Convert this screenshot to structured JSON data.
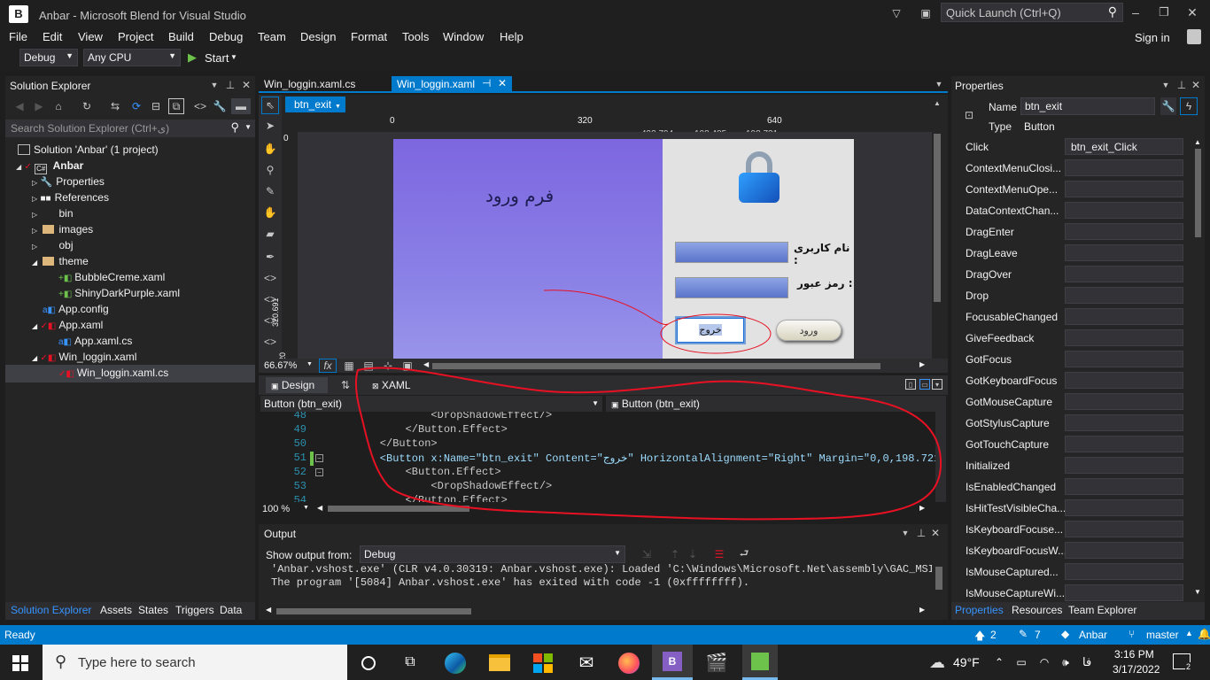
{
  "window": {
    "title": "Anbar - Microsoft Blend for Visual Studio",
    "quick_launch": "Quick Launch (Ctrl+Q)",
    "sign_in": "Sign in"
  },
  "menu": [
    "File",
    "Edit",
    "View",
    "Project",
    "Build",
    "Debug",
    "Team",
    "Design",
    "Format",
    "Tools",
    "Window",
    "Help"
  ],
  "toolbar": {
    "config": "Debug",
    "platform": "Any CPU",
    "start": "Start"
  },
  "solution_explorer": {
    "title": "Solution Explorer",
    "search_placeholder": "Search Solution Explorer (Ctrl+ی)",
    "items": [
      {
        "label": "Solution 'Anbar' (1 project)",
        "icon": "solution-icon"
      },
      {
        "label": "Anbar",
        "icon": "csharp-project-icon"
      },
      {
        "label": "Properties",
        "icon": "wrench-icon"
      },
      {
        "label": "References",
        "icon": "references-icon"
      },
      {
        "label": "bin",
        "icon": "folder-icon"
      },
      {
        "label": "images",
        "icon": "folder-icon"
      },
      {
        "label": "obj",
        "icon": "folder-icon"
      },
      {
        "label": "theme",
        "icon": "folder-icon"
      },
      {
        "label": "BubbleCreme.xaml",
        "icon": "xaml-file-icon"
      },
      {
        "label": "ShinyDarkPurple.xaml",
        "icon": "xaml-file-icon"
      },
      {
        "label": "App.config",
        "icon": "config-file-icon"
      },
      {
        "label": "App.xaml",
        "icon": "xaml-file-icon"
      },
      {
        "label": "App.xaml.cs",
        "icon": "cs-file-icon"
      },
      {
        "label": "Win_loggin.xaml",
        "icon": "xaml-file-icon"
      },
      {
        "label": "Win_loggin.xaml.cs",
        "icon": "cs-file-icon"
      }
    ],
    "bottom_tabs": [
      "Solution Explorer",
      "Assets",
      "States",
      "Triggers",
      "Data"
    ]
  },
  "doc_tabs": [
    "Win_loggin.xaml.cs",
    "Win_loggin.xaml"
  ],
  "designer": {
    "breadcrumb": "btn_exit",
    "ruler": [
      "0",
      "320",
      "640"
    ],
    "dims": [
      "492.794",
      "108.485",
      "198.721"
    ],
    "vruler": [
      "0",
      "320.691",
      "320"
    ],
    "zoom": "66.67%",
    "form_title": "فرم ورود",
    "username_label": "نام کاربری :",
    "password_label": "رمز عبور :",
    "exit_button": "خروج",
    "login_button": "ورود"
  },
  "split_tabs": {
    "design": "Design",
    "xaml": "XAML"
  },
  "code": {
    "left_combo": "Button (btn_exit)",
    "right_combo": "Button (btn_exit)",
    "lines": [
      {
        "n": "48",
        "text": "            <DropShadowEffect/>"
      },
      {
        "n": "49",
        "text": "        </Button.Effect>"
      },
      {
        "n": "50",
        "text": "    </Button>"
      },
      {
        "n": "51",
        "text": "    <Button x:Name=\"btn_exit\" Content=\"خروج\" HorizontalAlignment=\"Right\" Margin=\"0,0,198.721,"
      },
      {
        "n": "52",
        "text": "        <Button.Effect>"
      },
      {
        "n": "53",
        "text": "            <DropShadowEffect/>"
      },
      {
        "n": "54",
        "text": "        </Button.Effect>"
      }
    ],
    "zoom": "100 %"
  },
  "output": {
    "title": "Output",
    "show_from_label": "Show output from:",
    "source": "Debug",
    "lines": [
      "'Anbar.vshost.exe' (CLR v4.0.30319: Anbar.vshost.exe): Loaded 'C:\\Windows\\Microsoft.Net\\assembly\\GAC_MSIL\\",
      "The program '[5084] Anbar.vshost.exe' has exited with code -1 (0xffffffff)."
    ]
  },
  "properties": {
    "title": "Properties",
    "name_label": "Name",
    "name_value": "btn_exit",
    "type_label": "Type",
    "type_value": "Button",
    "events": [
      {
        "name": "Click",
        "value": "btn_exit_Click"
      },
      {
        "name": "ContextMenuClosi...",
        "value": ""
      },
      {
        "name": "ContextMenuOpe...",
        "value": ""
      },
      {
        "name": "DataContextChan...",
        "value": ""
      },
      {
        "name": "DragEnter",
        "value": ""
      },
      {
        "name": "DragLeave",
        "value": ""
      },
      {
        "name": "DragOver",
        "value": ""
      },
      {
        "name": "Drop",
        "value": ""
      },
      {
        "name": "FocusableChanged",
        "value": ""
      },
      {
        "name": "GiveFeedback",
        "value": ""
      },
      {
        "name": "GotFocus",
        "value": ""
      },
      {
        "name": "GotKeyboardFocus",
        "value": ""
      },
      {
        "name": "GotMouseCapture",
        "value": ""
      },
      {
        "name": "GotStylusCapture",
        "value": ""
      },
      {
        "name": "GotTouchCapture",
        "value": ""
      },
      {
        "name": "Initialized",
        "value": ""
      },
      {
        "name": "IsEnabledChanged",
        "value": ""
      },
      {
        "name": "IsHitTestVisibleCha...",
        "value": ""
      },
      {
        "name": "IsKeyboardFocuse...",
        "value": ""
      },
      {
        "name": "IsKeyboardFocusW...",
        "value": ""
      },
      {
        "name": "IsMouseCaptured...",
        "value": ""
      },
      {
        "name": "IsMouseCaptureWi...",
        "value": ""
      }
    ],
    "bottom_tabs": [
      "Properties",
      "Resources",
      "Team Explorer"
    ]
  },
  "status": {
    "ready": "Ready",
    "up": "2",
    "edits": "7",
    "repo": "Anbar",
    "branch": "master"
  },
  "taskbar": {
    "search": "Type here to search",
    "weather": "49°F",
    "lang": "فا",
    "time": "3:16 PM",
    "date": "3/17/2022",
    "notifications": "2"
  },
  "colors": {
    "accent": "#007acc",
    "annotation": "#e81123"
  }
}
